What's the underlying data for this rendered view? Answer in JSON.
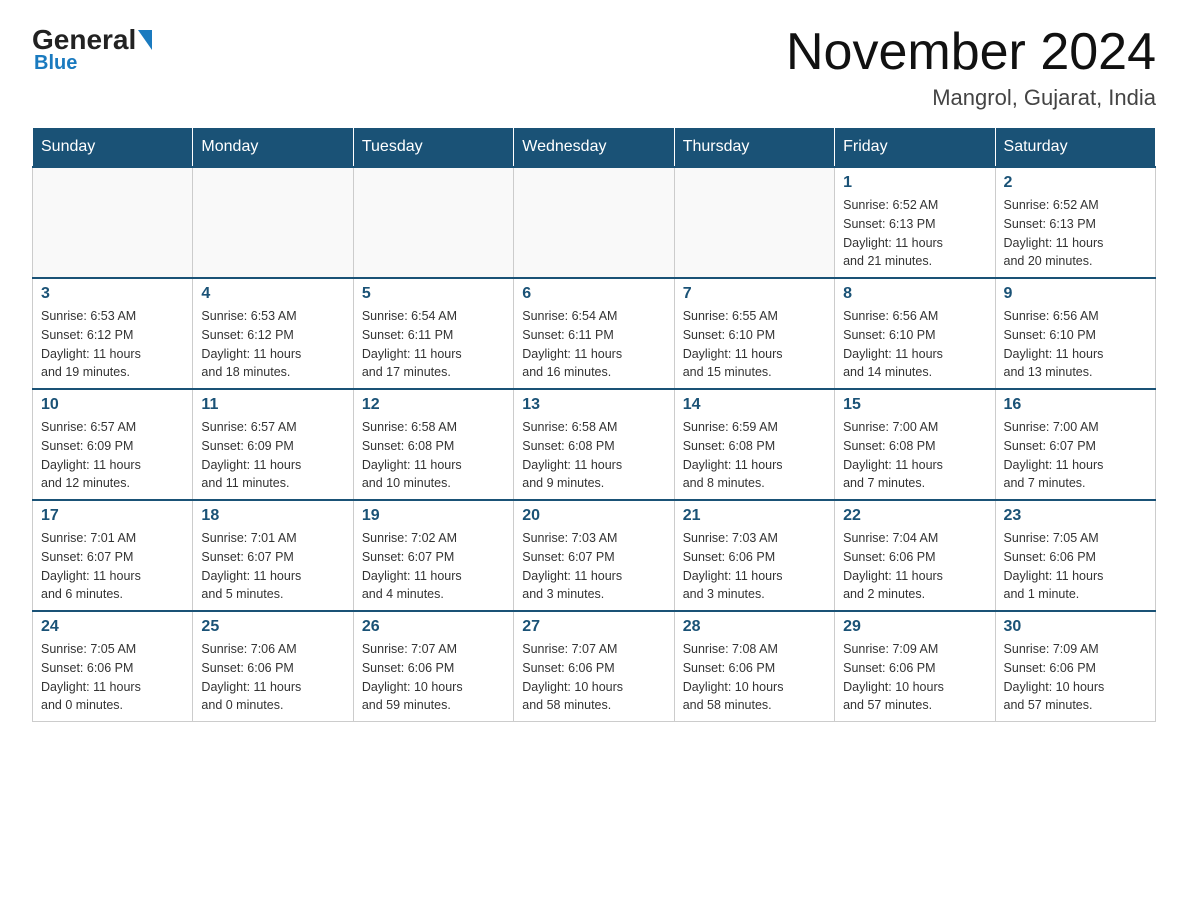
{
  "logo": {
    "main": "General",
    "sub": "Blue"
  },
  "title": "November 2024",
  "subtitle": "Mangrol, Gujarat, India",
  "weekdays": [
    "Sunday",
    "Monday",
    "Tuesday",
    "Wednesday",
    "Thursday",
    "Friday",
    "Saturday"
  ],
  "weeks": [
    [
      {
        "day": "",
        "info": ""
      },
      {
        "day": "",
        "info": ""
      },
      {
        "day": "",
        "info": ""
      },
      {
        "day": "",
        "info": ""
      },
      {
        "day": "",
        "info": ""
      },
      {
        "day": "1",
        "info": "Sunrise: 6:52 AM\nSunset: 6:13 PM\nDaylight: 11 hours\nand 21 minutes."
      },
      {
        "day": "2",
        "info": "Sunrise: 6:52 AM\nSunset: 6:13 PM\nDaylight: 11 hours\nand 20 minutes."
      }
    ],
    [
      {
        "day": "3",
        "info": "Sunrise: 6:53 AM\nSunset: 6:12 PM\nDaylight: 11 hours\nand 19 minutes."
      },
      {
        "day": "4",
        "info": "Sunrise: 6:53 AM\nSunset: 6:12 PM\nDaylight: 11 hours\nand 18 minutes."
      },
      {
        "day": "5",
        "info": "Sunrise: 6:54 AM\nSunset: 6:11 PM\nDaylight: 11 hours\nand 17 minutes."
      },
      {
        "day": "6",
        "info": "Sunrise: 6:54 AM\nSunset: 6:11 PM\nDaylight: 11 hours\nand 16 minutes."
      },
      {
        "day": "7",
        "info": "Sunrise: 6:55 AM\nSunset: 6:10 PM\nDaylight: 11 hours\nand 15 minutes."
      },
      {
        "day": "8",
        "info": "Sunrise: 6:56 AM\nSunset: 6:10 PM\nDaylight: 11 hours\nand 14 minutes."
      },
      {
        "day": "9",
        "info": "Sunrise: 6:56 AM\nSunset: 6:10 PM\nDaylight: 11 hours\nand 13 minutes."
      }
    ],
    [
      {
        "day": "10",
        "info": "Sunrise: 6:57 AM\nSunset: 6:09 PM\nDaylight: 11 hours\nand 12 minutes."
      },
      {
        "day": "11",
        "info": "Sunrise: 6:57 AM\nSunset: 6:09 PM\nDaylight: 11 hours\nand 11 minutes."
      },
      {
        "day": "12",
        "info": "Sunrise: 6:58 AM\nSunset: 6:08 PM\nDaylight: 11 hours\nand 10 minutes."
      },
      {
        "day": "13",
        "info": "Sunrise: 6:58 AM\nSunset: 6:08 PM\nDaylight: 11 hours\nand 9 minutes."
      },
      {
        "day": "14",
        "info": "Sunrise: 6:59 AM\nSunset: 6:08 PM\nDaylight: 11 hours\nand 8 minutes."
      },
      {
        "day": "15",
        "info": "Sunrise: 7:00 AM\nSunset: 6:08 PM\nDaylight: 11 hours\nand 7 minutes."
      },
      {
        "day": "16",
        "info": "Sunrise: 7:00 AM\nSunset: 6:07 PM\nDaylight: 11 hours\nand 7 minutes."
      }
    ],
    [
      {
        "day": "17",
        "info": "Sunrise: 7:01 AM\nSunset: 6:07 PM\nDaylight: 11 hours\nand 6 minutes."
      },
      {
        "day": "18",
        "info": "Sunrise: 7:01 AM\nSunset: 6:07 PM\nDaylight: 11 hours\nand 5 minutes."
      },
      {
        "day": "19",
        "info": "Sunrise: 7:02 AM\nSunset: 6:07 PM\nDaylight: 11 hours\nand 4 minutes."
      },
      {
        "day": "20",
        "info": "Sunrise: 7:03 AM\nSunset: 6:07 PM\nDaylight: 11 hours\nand 3 minutes."
      },
      {
        "day": "21",
        "info": "Sunrise: 7:03 AM\nSunset: 6:06 PM\nDaylight: 11 hours\nand 3 minutes."
      },
      {
        "day": "22",
        "info": "Sunrise: 7:04 AM\nSunset: 6:06 PM\nDaylight: 11 hours\nand 2 minutes."
      },
      {
        "day": "23",
        "info": "Sunrise: 7:05 AM\nSunset: 6:06 PM\nDaylight: 11 hours\nand 1 minute."
      }
    ],
    [
      {
        "day": "24",
        "info": "Sunrise: 7:05 AM\nSunset: 6:06 PM\nDaylight: 11 hours\nand 0 minutes."
      },
      {
        "day": "25",
        "info": "Sunrise: 7:06 AM\nSunset: 6:06 PM\nDaylight: 11 hours\nand 0 minutes."
      },
      {
        "day": "26",
        "info": "Sunrise: 7:07 AM\nSunset: 6:06 PM\nDaylight: 10 hours\nand 59 minutes."
      },
      {
        "day": "27",
        "info": "Sunrise: 7:07 AM\nSunset: 6:06 PM\nDaylight: 10 hours\nand 58 minutes."
      },
      {
        "day": "28",
        "info": "Sunrise: 7:08 AM\nSunset: 6:06 PM\nDaylight: 10 hours\nand 58 minutes."
      },
      {
        "day": "29",
        "info": "Sunrise: 7:09 AM\nSunset: 6:06 PM\nDaylight: 10 hours\nand 57 minutes."
      },
      {
        "day": "30",
        "info": "Sunrise: 7:09 AM\nSunset: 6:06 PM\nDaylight: 10 hours\nand 57 minutes."
      }
    ]
  ]
}
